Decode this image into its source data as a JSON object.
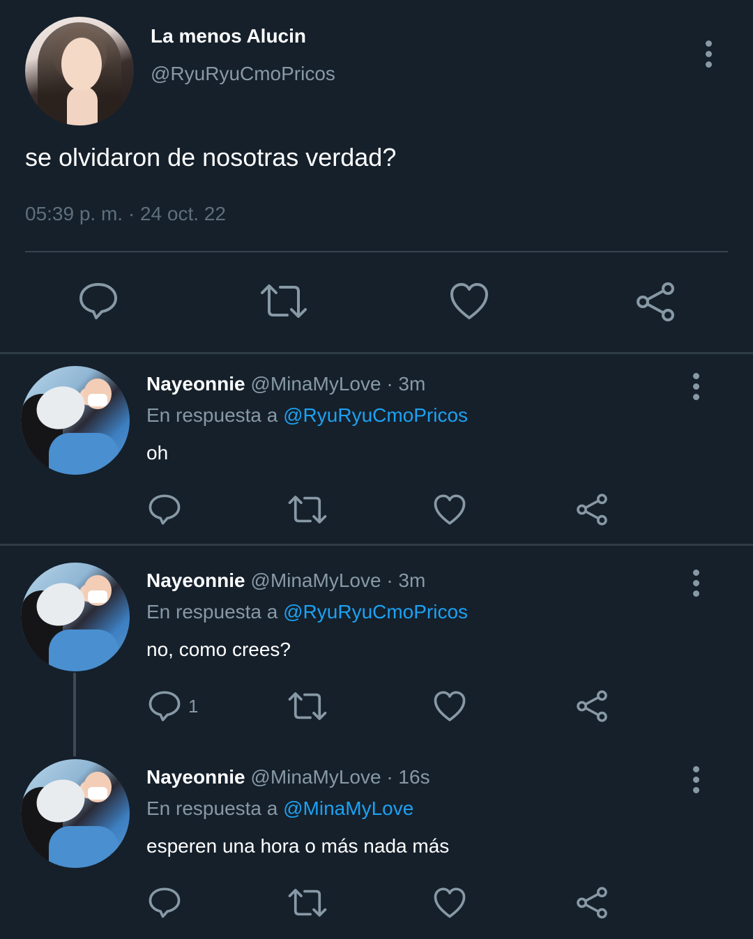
{
  "main_tweet": {
    "display_name": "La menos Alucin",
    "handle": "@RyuRyuCmoPricos",
    "text": "se olvidaron de nosotras verdad?",
    "timestamp": "05:39 p. m. · 24 oct. 22",
    "avatar_icon": "profile-photo",
    "actions": [
      "reply-icon",
      "retweet-icon",
      "like-icon",
      "share-icon"
    ]
  },
  "replies": [
    {
      "display_name": "Nayeonnie",
      "meta": "@MinaMyLove · 3m",
      "replying_prefix": "En respuesta a",
      "replying_to": "@RyuRyuCmoPricos",
      "text": "oh",
      "reply_count": ""
    },
    {
      "display_name": "Nayeonnie",
      "meta": "@MinaMyLove · 3m",
      "replying_prefix": "En respuesta a",
      "replying_to": "@RyuRyuCmoPricos",
      "text": "no, como crees?",
      "reply_count": "1"
    },
    {
      "display_name": "Nayeonnie",
      "meta": "@MinaMyLove · 16s",
      "replying_prefix": "En respuesta a",
      "replying_to": "@MinaMyLove",
      "text": "esperen una hora o más nada más",
      "reply_count": ""
    }
  ],
  "colors": {
    "background": "#15202b",
    "primary_text": "#ffffff",
    "secondary_text": "#8899a6",
    "link": "#1da1f2",
    "divider": "#38444d"
  }
}
